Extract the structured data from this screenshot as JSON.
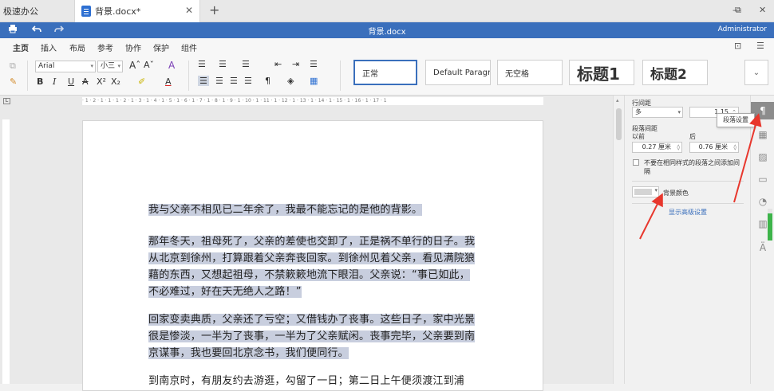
{
  "tabs": [
    {
      "label": "极速办公"
    },
    {
      "label": "背景.docx*"
    }
  ],
  "quick_access": {
    "print_icon": "printer-icon",
    "undo_icon": "undo-icon",
    "redo_icon": "redo-icon"
  },
  "window": {
    "minimize": "—",
    "restore": "⧉",
    "close": "✕"
  },
  "document_title": "背景.docx",
  "user": "Administrator",
  "menu": [
    "主页",
    "插入",
    "布局",
    "参考",
    "协作",
    "保护",
    "组件"
  ],
  "ribbon": {
    "font_name": "Arial",
    "font_size": "小三",
    "styles": [
      "正常",
      "Default Paragr",
      "无空格",
      "标题1",
      "标题2"
    ]
  },
  "ruler": {
    "marks": "· 1 · 2 · 1 · 1 · 1 · 2 · 1 · 3 · 1 · 4 · 1 · 5 · 1 · 6 · 1 · 7 · 1 · 8 · 1 · 9 · 1 · 10 · 1 · 11 · 1 · 12 · 1 · 13 · 1 · 14 · 1 · 15 · 1 · 16 · 1 · 17 · 1"
  },
  "document": {
    "paragraphs": [
      [
        "我与父亲不相见已二年余了，我最不能忘记的是他的背影。"
      ],
      [
        "那年冬天，祖母死了，父亲的差使也交卸了，正是祸不单行的日子。我",
        "从北京到徐州，打算跟着父亲奔丧回家。到徐州见着父亲，看见满院狼",
        "藉的东西，又想起祖母，不禁簌簌地流下眼泪。父亲说：“事已如此，",
        "不必难过，好在天无绝人之路！”"
      ],
      [
        "回家变卖典质，父亲还了亏空；又借钱办了丧事。这些日子，家中光景",
        "很是惨淡，一半为了丧事，一半为了父亲赋闲。丧事完毕，父亲要到南",
        "京谋事，我也要回北京念书，我们便同行。"
      ],
      [
        "到南京时，有朋友约去游逛，勾留了一日；第二日上午便须渡江到浦"
      ]
    ]
  },
  "panel": {
    "line_spacing_label": "行间距",
    "line_spacing_type": "多",
    "line_spacing_value": "1.15",
    "paragraph_spacing_label": "段落间距",
    "before_label": "以前",
    "after_label": "后",
    "before_value": "0.27 厘米",
    "after_value": "0.76 厘米",
    "no_space_same_style": "不要在相同样式的段落之间添加间隔",
    "background_color_label": "背景颜色",
    "advanced_link": "显示高级设置",
    "background_color": "#d4d4d4"
  },
  "tooltip": "段落设置",
  "right_toolbar": [
    "paragraph-icon",
    "table-icon",
    "image-icon",
    "header-footer-icon",
    "shape-icon",
    "chart-icon",
    "text-art-icon"
  ],
  "colors": {
    "accent": "#3a6fbc",
    "highlight": "#c8cede",
    "arrow": "#e8372d"
  }
}
